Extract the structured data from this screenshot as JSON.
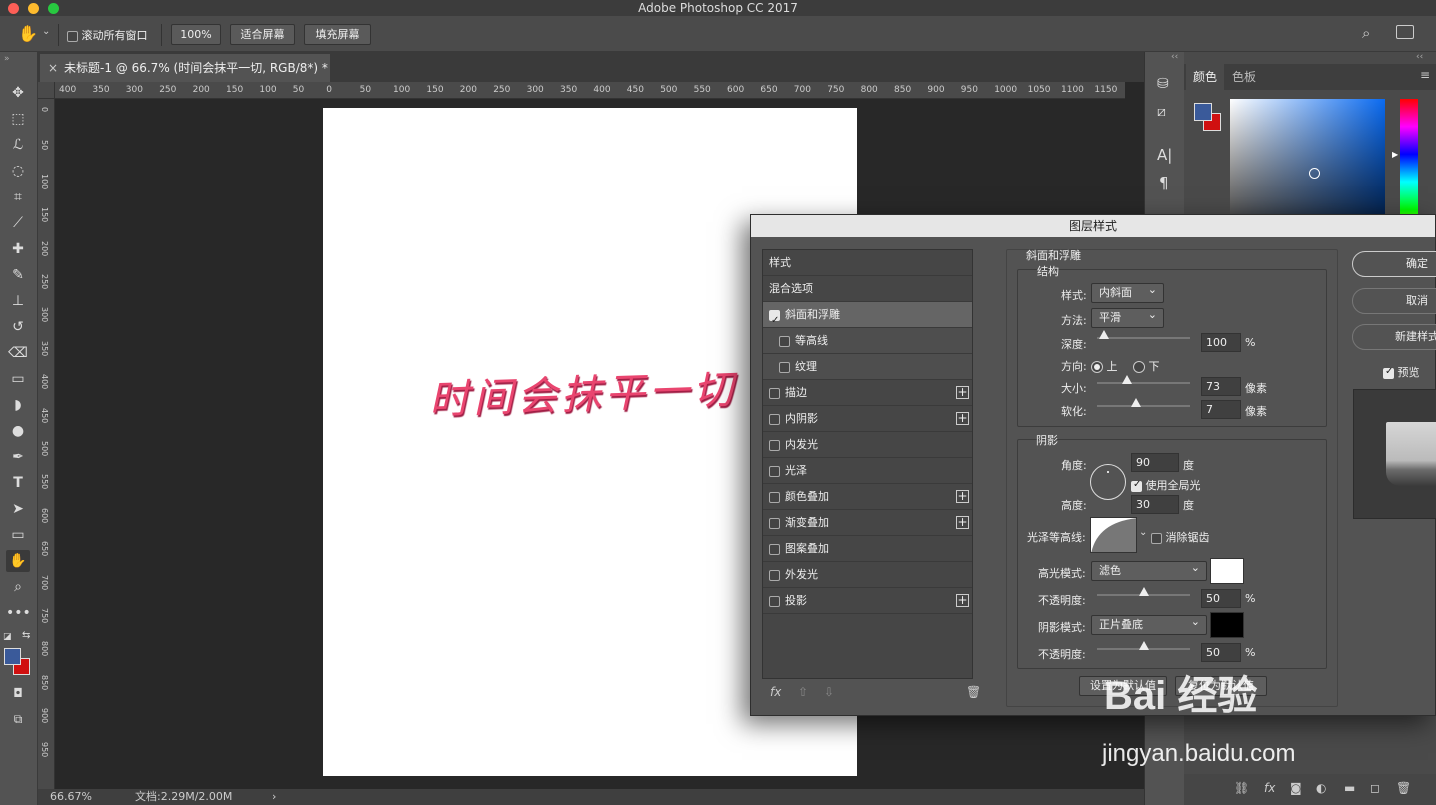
{
  "window": {
    "title": "Adobe Photoshop CC 2017"
  },
  "options_bar": {
    "scroll_all_windows": "滚动所有窗口",
    "zoom_100": "100%",
    "fit_screen": "适合屏幕",
    "fill_screen": "填充屏幕"
  },
  "document": {
    "tab_title": "未标题-1 @ 66.7% (时间会抹平一切, RGB/8*) *",
    "text_layer": "时间会抹平一切",
    "text_color": "#e9456f"
  },
  "ruler": {
    "h_ticks": [
      "400",
      "350",
      "300",
      "250",
      "200",
      "150",
      "100",
      "50",
      "0",
      "50",
      "100",
      "150",
      "200",
      "250",
      "300",
      "350",
      "400",
      "450",
      "500",
      "550",
      "600",
      "650",
      "700",
      "750",
      "800",
      "850",
      "900",
      "950",
      "1000",
      "1050",
      "1100",
      "1150"
    ],
    "v_ticks": [
      "0",
      "50",
      "100",
      "150",
      "200",
      "250",
      "300",
      "350",
      "400",
      "450",
      "500",
      "550",
      "600",
      "650",
      "700",
      "750",
      "800",
      "850",
      "900",
      "950"
    ]
  },
  "status": {
    "zoom": "66.67%",
    "doc_size": "文档:2.29M/2.00M",
    "arrow": "›"
  },
  "right_panel": {
    "tabs": [
      "颜色",
      "色板"
    ],
    "fg_color": "#3a5a9a",
    "bg_color": "#d01010"
  },
  "dialog": {
    "title": "图层样式",
    "styles_header": "样式",
    "blend_options": "混合选项",
    "style_items": [
      {
        "label": "斜面和浮雕",
        "checked": true,
        "plus": false,
        "indent": false,
        "selected": true
      },
      {
        "label": "等高线",
        "checked": false,
        "plus": false,
        "indent": true,
        "selected": false
      },
      {
        "label": "纹理",
        "checked": false,
        "plus": false,
        "indent": true,
        "selected": false
      },
      {
        "label": "描边",
        "checked": false,
        "plus": true,
        "indent": false,
        "selected": false
      },
      {
        "label": "内阴影",
        "checked": false,
        "plus": true,
        "indent": false,
        "selected": false
      },
      {
        "label": "内发光",
        "checked": false,
        "plus": false,
        "indent": false,
        "selected": false
      },
      {
        "label": "光泽",
        "checked": false,
        "plus": false,
        "indent": false,
        "selected": false
      },
      {
        "label": "颜色叠加",
        "checked": false,
        "plus": true,
        "indent": false,
        "selected": false
      },
      {
        "label": "渐变叠加",
        "checked": false,
        "plus": true,
        "indent": false,
        "selected": false
      },
      {
        "label": "图案叠加",
        "checked": false,
        "plus": false,
        "indent": false,
        "selected": false
      },
      {
        "label": "外发光",
        "checked": false,
        "plus": false,
        "indent": false,
        "selected": false
      },
      {
        "label": "投影",
        "checked": false,
        "plus": true,
        "indent": false,
        "selected": false
      }
    ],
    "fx_label": "fx",
    "bevel": {
      "section_title": "斜面和浮雕",
      "structure_title": "结构",
      "style_label": "样式:",
      "style_value": "内斜面",
      "technique_label": "方法:",
      "technique_value": "平滑",
      "depth_label": "深度:",
      "depth_value": "100",
      "depth_unit": "%",
      "depth_pos": 0.08,
      "direction_label": "方向:",
      "dir_up": "上",
      "dir_down": "下",
      "size_label": "大小:",
      "size_value": "73",
      "size_unit": "像素",
      "size_pos": 0.32,
      "soften_label": "软化:",
      "soften_value": "7",
      "soften_unit": "像素",
      "soften_pos": 0.42
    },
    "shading": {
      "title": "阴影",
      "angle_label": "角度:",
      "angle_value": "90",
      "angle_unit": "度",
      "global_light": "使用全局光",
      "altitude_label": "高度:",
      "altitude_value": "30",
      "altitude_unit": "度",
      "gloss_contour_label": "光泽等高线:",
      "anti_aliased": "消除锯齿",
      "highlight_mode_label": "高光模式:",
      "highlight_mode_value": "滤色",
      "highlight_color": "#ffffff",
      "hl_opacity_label": "不透明度:",
      "hl_opacity_value": "50",
      "hl_opacity_unit": "%",
      "hl_opacity_pos": 0.5,
      "shadow_mode_label": "阴影模式:",
      "shadow_mode_value": "正片叠底",
      "shadow_color": "#000000",
      "sh_opacity_label": "不透明度:",
      "sh_opacity_value": "50",
      "sh_opacity_unit": "%",
      "sh_opacity_pos": 0.5
    },
    "make_default": "设置为默认值",
    "reset_default": "复位为默认值",
    "ok": "确定",
    "cancel": "取消",
    "new_style": "新建样式",
    "preview": "预览"
  },
  "watermark": {
    "brand": "Bai 经验",
    "url": "jingyan.baidu.com"
  }
}
